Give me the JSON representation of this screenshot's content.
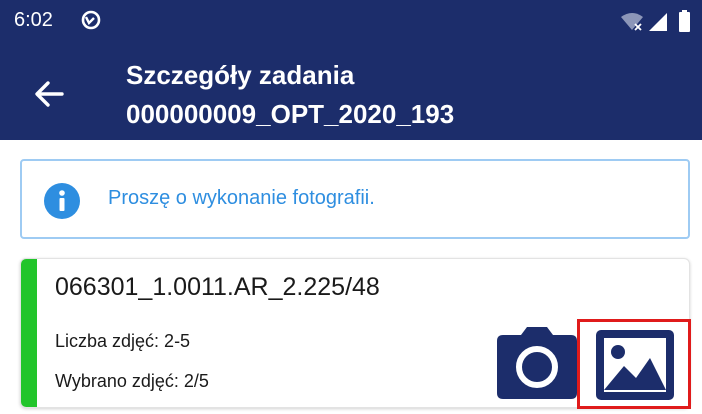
{
  "status_bar": {
    "time": "6:02"
  },
  "app_bar": {
    "title_line1": "Szczegóły zadania",
    "title_line2": "000000009_OPT_2020_193"
  },
  "info": {
    "message": "Proszę o wykonanie fotografii."
  },
  "card": {
    "title": "066301_1.0011.AR_2.225/48",
    "photo_count_label": "Liczba zdjęć: 2-5",
    "selected_label": "Wybrano zdjęć: 2/5"
  },
  "colors": {
    "header_bg": "#1c2d6b",
    "info_border": "#9ecbf3",
    "info_text": "#2e8ee0",
    "card_accent": "#22c52b",
    "highlight_border": "#e01b1b"
  },
  "icons": {
    "sync": "sync-icon",
    "wifi": "wifi-icon",
    "signal": "signal-icon",
    "battery": "battery-icon",
    "back": "arrow-back-icon",
    "info": "info-icon",
    "camera": "camera-icon",
    "gallery": "gallery-image-icon"
  }
}
